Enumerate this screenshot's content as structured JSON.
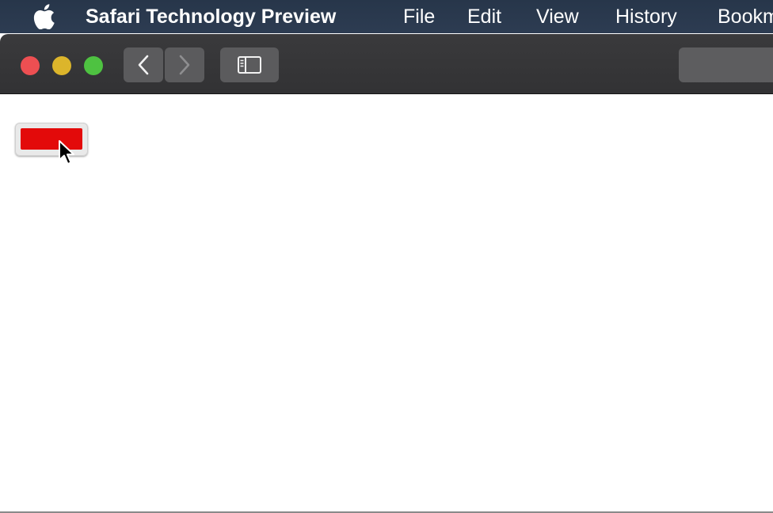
{
  "menubar": {
    "apple_icon": "apple-logo-icon",
    "app_name": "Safari Technology Preview",
    "items": [
      "File",
      "Edit",
      "View",
      "History",
      "Bookmarks"
    ]
  },
  "toolbar": {
    "traffic_lights": {
      "close_color": "#ed4f52",
      "minimize_color": "#dcb52b",
      "zoom_color": "#4ec241"
    },
    "back_icon": "chevron-left-icon",
    "forward_icon": "chevron-right-icon",
    "sidebar_icon": "sidebar-icon"
  },
  "page": {
    "button_color": "#e30a0a",
    "cursor_icon": "arrow-cursor-icon"
  }
}
